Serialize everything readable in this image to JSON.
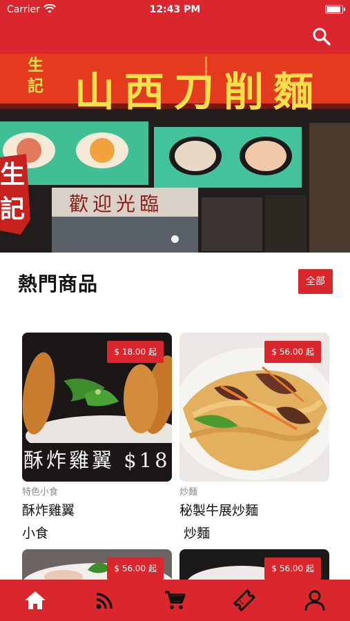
{
  "status_bar": {
    "carrier": "Carrier",
    "time": "12:43 PM"
  },
  "header": {
    "search_icon": "search-icon"
  },
  "banner": {
    "sign_main": "山西刀削麵",
    "sign_small": "生記",
    "welcome": "歡迎光臨",
    "side_logo": "生記",
    "slide_indicator": "1"
  },
  "section": {
    "title": "熱門商品",
    "all_label": "全部"
  },
  "products": [
    {
      "price": "$ 18.00 起",
      "category": "特色小食",
      "name": "酥炸雞翼",
      "sub": "小食",
      "overlay_text": "酥炸雞翼 $18"
    },
    {
      "price": "$ 56.00 起",
      "category": "炒麵",
      "name": "秘製牛展炒麵",
      "sub": " 炒麵"
    },
    {
      "price": "$ 56.00 起"
    },
    {
      "price": "$ 56.00 起"
    }
  ],
  "tabbar": {
    "items": [
      {
        "icon": "home-icon"
      },
      {
        "icon": "rss-feed-icon"
      },
      {
        "icon": "cart-icon"
      },
      {
        "icon": "ticket-icon"
      },
      {
        "icon": "user-icon"
      }
    ]
  },
  "colors": {
    "primary": "#d9272d",
    "text": "#111111",
    "muted": "#8a8a8a"
  }
}
